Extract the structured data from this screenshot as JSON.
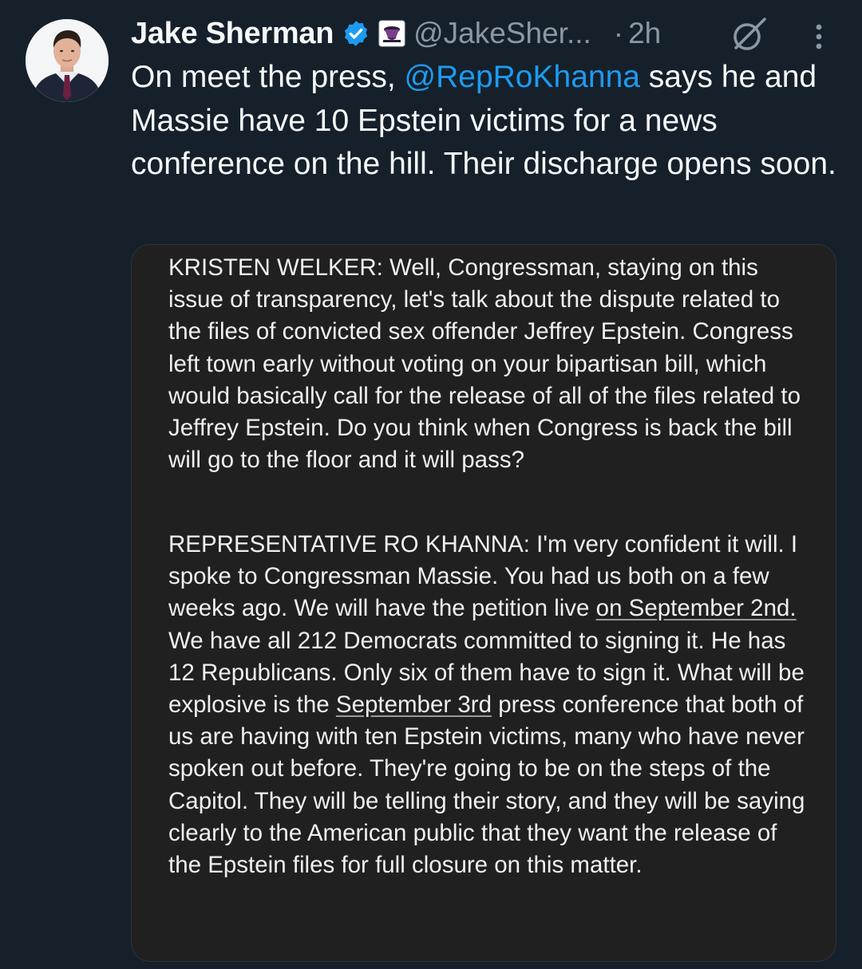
{
  "author": {
    "name": "Jake Sherman",
    "handle": "@JakeSher...",
    "separator": "·",
    "time": "2h"
  },
  "icons": {
    "verified": "verified-badge-icon",
    "affiliate": "affiliate-badge-icon",
    "grok": "grok-icon",
    "more": "more-options-icon",
    "accent": "#1d9bf0"
  },
  "tweet": {
    "text_before": "On meet the press, ",
    "mention": "@RepRoKhanna",
    "text_after": " says he and Massie have 10 Epstein victims for a news conference on the hill. Their discharge opens soon."
  },
  "image": {
    "para1": "KRISTEN WELKER: Well, Congressman, staying on this issue of transparency, let's talk about the dispute related to the files of convicted sex offender Jeffrey Epstein. Congress left town early without voting on your bipartisan bill, which would basically call for the release of all of the files related to Jeffrey Epstein. Do you think when Congress is back the bill will go to the floor and it will pass?",
    "para2_a": "REPRESENTATIVE RO KHANNA: I'm very confident it will. I spoke to Congressman Massie. You had us both on a few weeks ago. We will have the petition live ",
    "para2_link1": "on September 2nd.",
    "para2_b": " We have all 212 Democrats committed to signing it. He has 12 Republicans. Only six of them have to sign it. What will be explosive is the ",
    "para2_link2": "September 3rd",
    "para2_c": " press conference that both of us are having with ten Epstein victims, many who have never spoken out before. They're going to be on the steps of the Capitol. They will be telling their story, and they will be saying clearly to the American public that they want the release of the Epstein files for full closure on this matter."
  }
}
